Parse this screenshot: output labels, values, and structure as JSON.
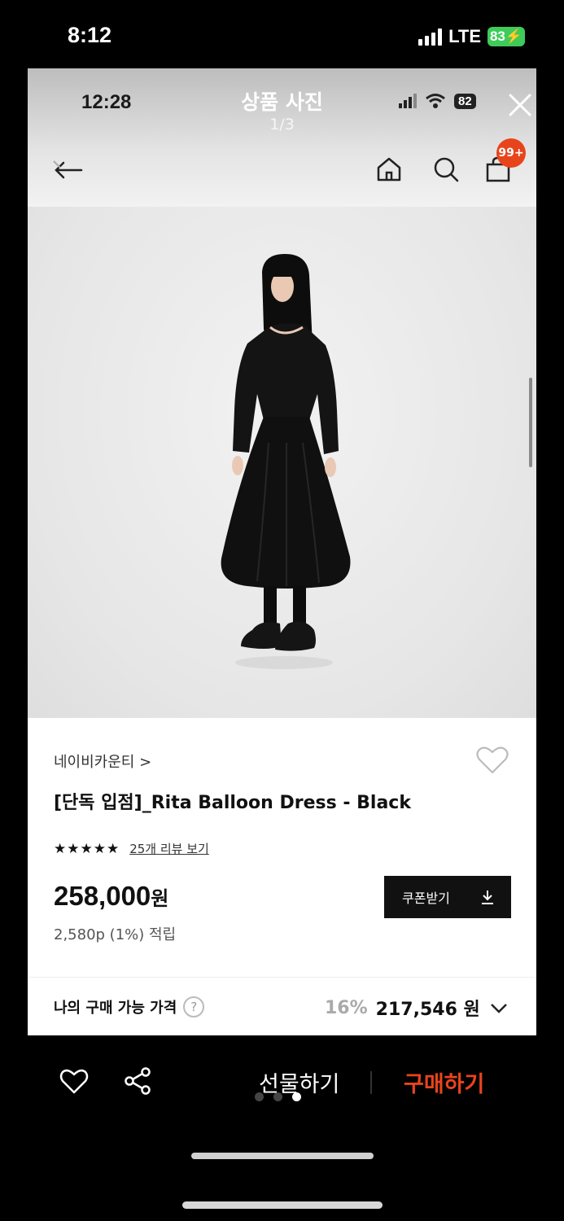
{
  "outer_status": {
    "time": "8:12",
    "network": "LTE",
    "battery": "83"
  },
  "viewer": {
    "inner_time": "12:28",
    "title": "상품 사진",
    "counter": "1/3",
    "inner_battery": "82",
    "cart_badge": "99+"
  },
  "product": {
    "brand": "네이비카운티 >",
    "name": "[단독 입점]_Rita Balloon Dress - Black",
    "stars": "★★★★★",
    "review_link": "25개 리뷰 보기",
    "price": "258,000",
    "price_unit": "원",
    "points": "2,580p (1%) 적립",
    "coupon_label": "쿠폰받기",
    "my_price_label": "나의 구매 가능 가격",
    "help_icon_glyph": "?",
    "discount_pct": "16%",
    "discount_price": "217,546 원"
  },
  "bottom": {
    "gift_label": "선물하기",
    "buy_label": "구매하기",
    "page_dots": {
      "count": 3,
      "active_index": 2
    }
  },
  "colors": {
    "accent": "#e8441c",
    "battery_green": "#3ecb5a"
  }
}
